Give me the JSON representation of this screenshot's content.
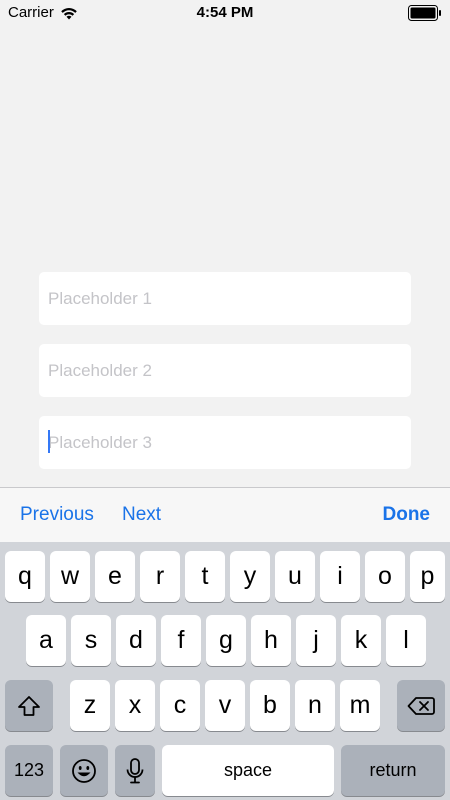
{
  "status_bar": {
    "carrier": "Carrier",
    "time": "4:54 PM"
  },
  "fields": [
    {
      "placeholder": "Placeholder 1",
      "value": ""
    },
    {
      "placeholder": "Placeholder 2",
      "value": ""
    },
    {
      "placeholder": "Placeholder 3",
      "value": "",
      "focused": true
    }
  ],
  "toolbar": {
    "previous_label": "Previous",
    "next_label": "Next",
    "done_label": "Done"
  },
  "keyboard": {
    "row1": [
      "q",
      "w",
      "e",
      "r",
      "t",
      "y",
      "u",
      "i",
      "o",
      "p"
    ],
    "row2": [
      "a",
      "s",
      "d",
      "f",
      "g",
      "h",
      "j",
      "k",
      "l"
    ],
    "row3": [
      "z",
      "x",
      "c",
      "v",
      "b",
      "n",
      "m"
    ],
    "numbers_label": "123",
    "space_label": "space",
    "return_label": "return",
    "icons": {
      "shift": "shift-icon",
      "delete": "delete-icon",
      "emoji": "emoji-icon",
      "dictation": "microphone-icon"
    }
  },
  "colors": {
    "accent": "#1a73e8",
    "background": "#f2f2f2",
    "keyboard_background": "#d1d4d9",
    "special_key": "#abb1ba"
  }
}
